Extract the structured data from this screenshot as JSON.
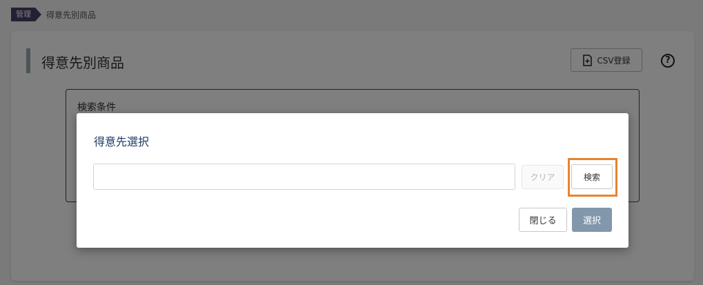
{
  "breadcrumb": {
    "tag": "管理",
    "current": "得意先別商品"
  },
  "header": {
    "title": "得意先別商品",
    "csv_button": "CSV登録",
    "help_icon": "help-circle-icon",
    "help_glyph": "?"
  },
  "search_panel": {
    "title": "検索条件"
  },
  "modal": {
    "title": "得意先選択",
    "input_value": "",
    "input_placeholder": "",
    "clear_label": "クリア",
    "search_label": "検索",
    "close_label": "閉じる",
    "select_label": "選択"
  },
  "colors": {
    "brand_tag": "#4a3f6b",
    "highlight": "#e8832e",
    "primary_button": "#8296ac",
    "panel_border": "#274a7b"
  }
}
